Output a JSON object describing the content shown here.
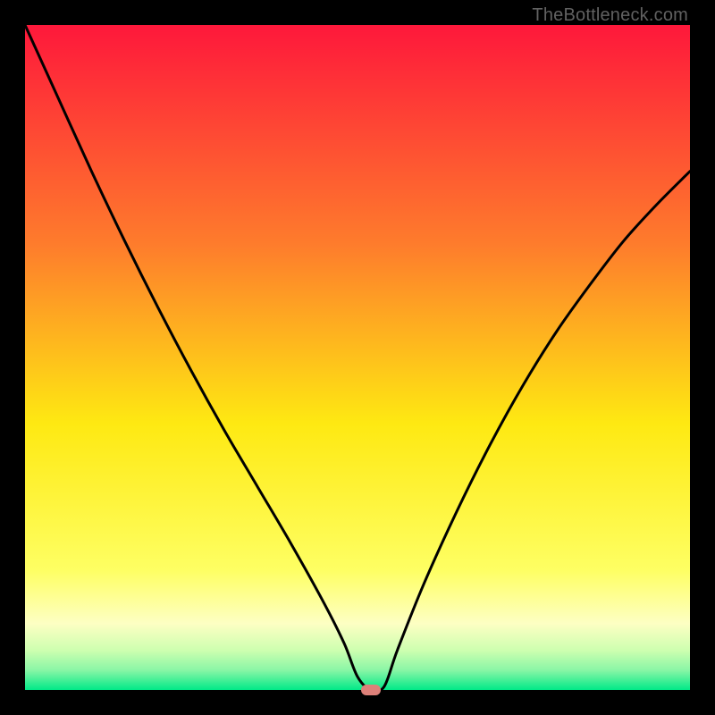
{
  "watermark": "TheBottleneck.com",
  "colors": {
    "top": "#fe183b",
    "mid1": "#fe7c2c",
    "mid2": "#fee912",
    "mid3": "#feff63",
    "mid4": "#e8ffa8",
    "bottom": "#00e988",
    "curve": "#000000",
    "marker": "#dd8079",
    "frame": "#000000"
  },
  "chart_data": {
    "type": "line",
    "title": "",
    "xlabel": "",
    "ylabel": "",
    "xlim": [
      0,
      100
    ],
    "ylim": [
      0,
      100
    ],
    "min_point_x": 52,
    "series": [
      {
        "name": "bottleneck-curve",
        "x": [
          0,
          5,
          10,
          15,
          20,
          25,
          30,
          35,
          40,
          45,
          48,
          50,
          52,
          54,
          56,
          60,
          65,
          70,
          75,
          80,
          85,
          90,
          95,
          100
        ],
        "y": [
          100,
          89,
          78,
          67.5,
          57.5,
          48,
          39,
          30.5,
          22,
          13,
          7,
          2,
          0,
          0.5,
          6,
          16,
          27,
          37,
          46,
          54,
          61,
          67.5,
          73,
          78
        ]
      }
    ],
    "annotations": [
      {
        "type": "marker",
        "x": 52,
        "y": 0,
        "label": "optimal-point"
      }
    ]
  }
}
